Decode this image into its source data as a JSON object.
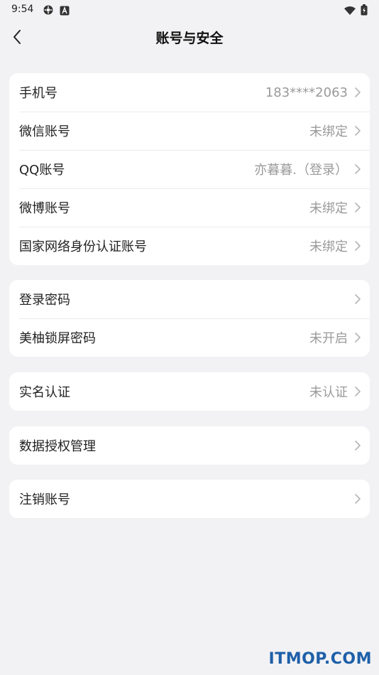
{
  "status_bar": {
    "time": "9:54"
  },
  "header": {
    "title": "账号与安全"
  },
  "sections": {
    "accounts": [
      {
        "label": "手机号",
        "value": "183****2063"
      },
      {
        "label": "微信账号",
        "value": "未绑定"
      },
      {
        "label": "QQ账号",
        "value": "亦暮暮.（登录）"
      },
      {
        "label": "微博账号",
        "value": "未绑定"
      },
      {
        "label": "国家网络身份认证账号",
        "value": "未绑定"
      }
    ],
    "security": [
      {
        "label": "登录密码",
        "value": ""
      },
      {
        "label": "美柚锁屏密码",
        "value": "未开启"
      }
    ],
    "verification": [
      {
        "label": "实名认证",
        "value": "未认证"
      }
    ],
    "data": [
      {
        "label": "数据授权管理",
        "value": ""
      }
    ],
    "cancel": [
      {
        "label": "注销账号",
        "value": ""
      }
    ]
  },
  "watermark": "ITMOP.COM",
  "colors": {
    "background": "#f2f2f4",
    "card": "#ffffff",
    "secondary_text": "#9a9a9a"
  },
  "icons": [
    "settings-gear-icon",
    "text-a-icon",
    "wifi-icon",
    "battery-icon",
    "back-chevron-icon",
    "chevron-right-icon"
  ]
}
